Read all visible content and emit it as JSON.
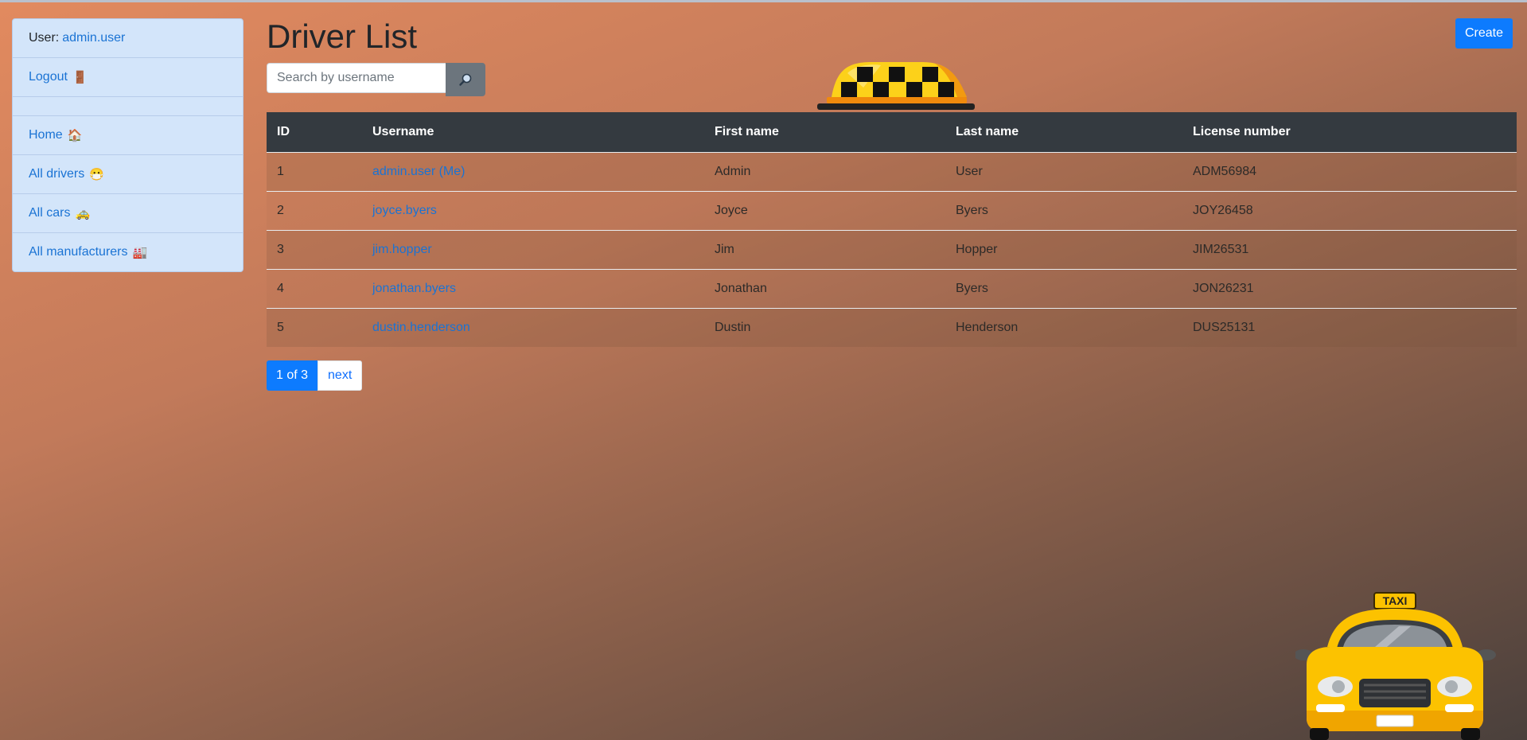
{
  "sidebar": {
    "user_label": "User:",
    "user_name": "admin.user",
    "logout": "Logout",
    "logout_emoji": "🚪",
    "items": [
      {
        "label": "Home",
        "emoji": "🏠"
      },
      {
        "label": "All drivers",
        "emoji": "😷"
      },
      {
        "label": "All cars",
        "emoji": "🚕"
      },
      {
        "label": "All manufacturers",
        "emoji": "🏭"
      }
    ]
  },
  "page": {
    "title": "Driver List",
    "create_label": "Create"
  },
  "search": {
    "placeholder": "Search by username",
    "button_icon": "search-icon"
  },
  "table": {
    "headers": [
      "ID",
      "Username",
      "First name",
      "Last name",
      "License number"
    ],
    "rows": [
      {
        "id": "1",
        "username": "admin.user (Me)",
        "first": "Admin",
        "last": "User",
        "license": "ADM56984"
      },
      {
        "id": "2",
        "username": "joyce.byers",
        "first": "Joyce",
        "last": "Byers",
        "license": "JOY26458"
      },
      {
        "id": "3",
        "username": "jim.hopper",
        "first": "Jim",
        "last": "Hopper",
        "license": "JIM26531"
      },
      {
        "id": "4",
        "username": "jonathan.byers",
        "first": "Jonathan",
        "last": "Byers",
        "license": "JON26231"
      },
      {
        "id": "5",
        "username": "dustin.henderson",
        "first": "Dustin",
        "last": "Henderson",
        "license": "DUS25131"
      }
    ]
  },
  "pagination": {
    "current": "1 of 3",
    "next": "next"
  },
  "images": {
    "car_sign_text": "TAXI"
  },
  "colors": {
    "accent": "#0d7bfe",
    "header_bg": "#343a40",
    "sidebar_bg": "#d3e5fa",
    "taxi_yellow": "#fcc200"
  }
}
